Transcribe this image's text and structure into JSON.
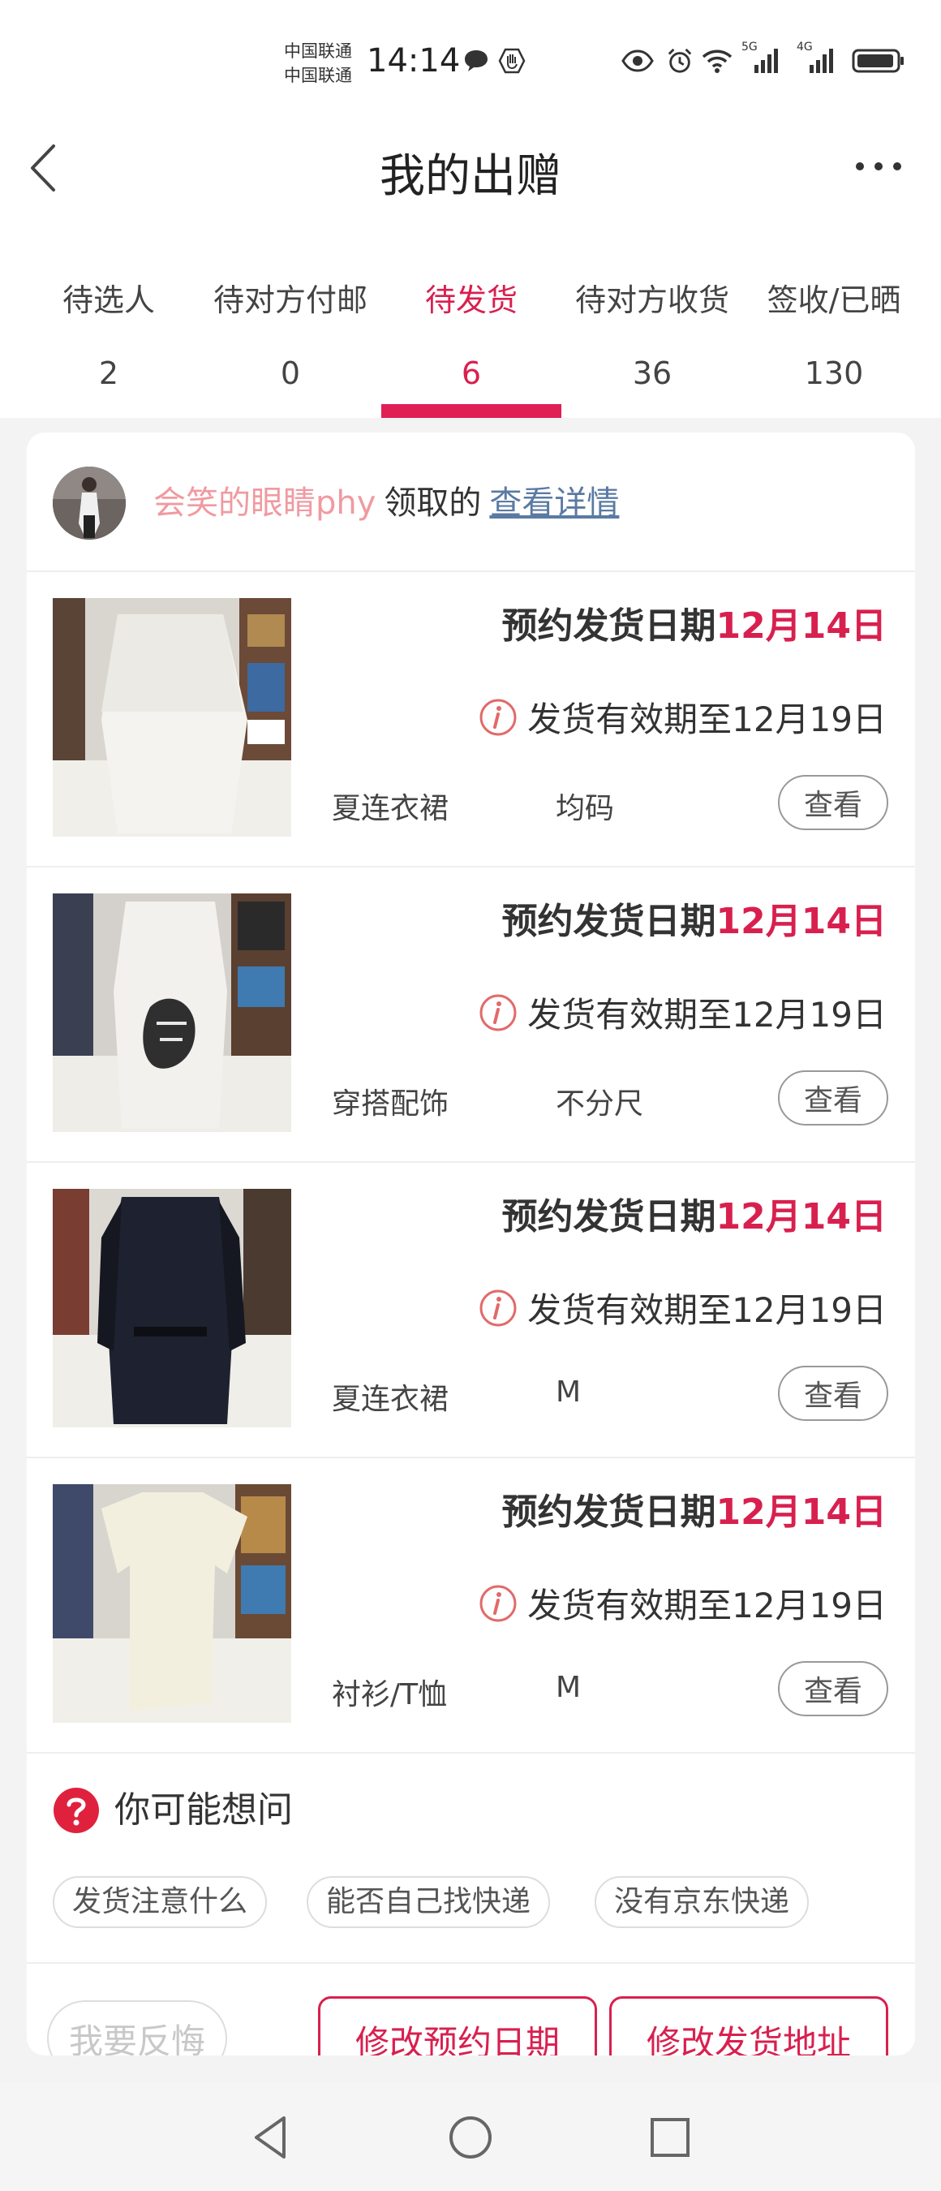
{
  "status": {
    "carrier1": "中国联通",
    "carrier2": "中国联通",
    "time": "14:14",
    "network1": "5G",
    "network2": "4G"
  },
  "header": {
    "title": "我的出赠"
  },
  "tabs": [
    {
      "label": "待选人",
      "count": "2"
    },
    {
      "label": "待对方付邮",
      "count": "0"
    },
    {
      "label": "待发货",
      "count": "6",
      "active": true
    },
    {
      "label": "待对方收货",
      "count": "36"
    },
    {
      "label": "签收/已晒",
      "count": "130"
    }
  ],
  "giver": {
    "name": "会笑的眼睛phy",
    "suffix": "领取的",
    "link": "查看详情"
  },
  "items": [
    {
      "ship_label": "预约发货日期",
      "ship_date": "12月14日",
      "validity": "发货有效期至12月19日",
      "category": "夏连衣裙",
      "size": "均码",
      "view": "查看"
    },
    {
      "ship_label": "预约发货日期",
      "ship_date": "12月14日",
      "validity": "发货有效期至12月19日",
      "category": "穿搭配饰",
      "size": "不分尺",
      "view": "查看"
    },
    {
      "ship_label": "预约发货日期",
      "ship_date": "12月14日",
      "validity": "发货有效期至12月19日",
      "category": "夏连衣裙",
      "size": "M",
      "view": "查看"
    },
    {
      "ship_label": "预约发货日期",
      "ship_date": "12月14日",
      "validity": "发货有效期至12月19日",
      "category": "衬衫/T恤",
      "size": "M",
      "view": "查看"
    }
  ],
  "faq": {
    "title": "你可能想问",
    "chips": [
      "发货注意什么",
      "能否自己找快递",
      "没有京东快递"
    ]
  },
  "actions": {
    "regret": "我要反悔",
    "change_date": "修改预约日期",
    "change_address": "修改发货地址"
  },
  "colors": {
    "accent": "#d8204f",
    "name_pink": "#f09aa0",
    "link": "#5b7aa3"
  }
}
